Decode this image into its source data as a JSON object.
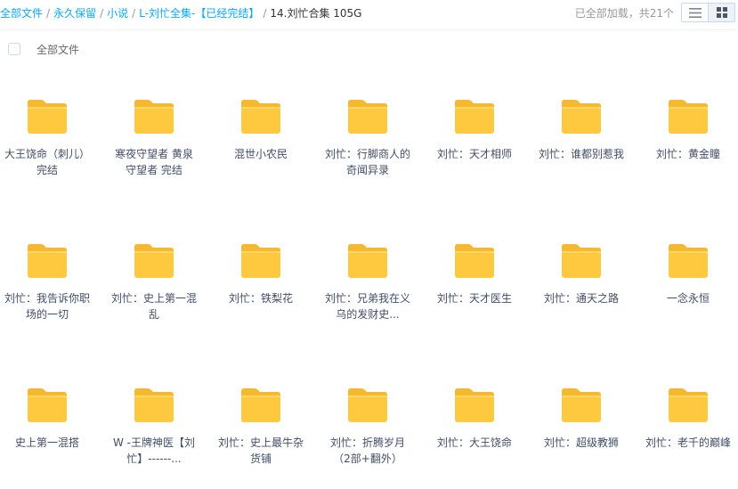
{
  "breadcrumb": {
    "crumbs": [
      "全部文件",
      "永久保留",
      "小说",
      "L-刘忙全集-【已经完结】"
    ],
    "current": "14.刘忙合集 105G"
  },
  "status": {
    "loaded_text": "已全部加载，共21个"
  },
  "view_toggle": {
    "list_icon": "list-view-icon",
    "grid_icon": "grid-view-icon",
    "active": "grid"
  },
  "header": {
    "select_all_label": "全部文件"
  },
  "colors": {
    "accent": "#09aaff",
    "folder": "#ffc93f",
    "folder_back": "#f5b82e",
    "text": "#424e67"
  },
  "folders": [
    {
      "name": "大王饶命（刺儿）完结"
    },
    {
      "name": "寒夜守望者 黄泉守望者 完结"
    },
    {
      "name": "混世小农民"
    },
    {
      "name": "刘忙：行脚商人的奇闻异录"
    },
    {
      "name": "刘忙：天才相师"
    },
    {
      "name": "刘忙：谁都别惹我"
    },
    {
      "name": "刘忙：黄金瞳"
    },
    {
      "name": "刘忙：我告诉你职场的一切"
    },
    {
      "name": "刘忙：史上第一混乱"
    },
    {
      "name": "刘忙：铁梨花"
    },
    {
      "name": "刘忙：兄弟我在义乌的发财史..."
    },
    {
      "name": "刘忙：天才医生"
    },
    {
      "name": "刘忙：通天之路"
    },
    {
      "name": "一念永恒"
    },
    {
      "name": "史上第一混搭"
    },
    {
      "name": "W -王牌神医【刘忙】------..."
    },
    {
      "name": "刘忙：史上最牛杂货铺"
    },
    {
      "name": "刘忙：折腾岁月（2部+翻外）"
    },
    {
      "name": "刘忙：大王饶命"
    },
    {
      "name": "刘忙：超级教狮"
    },
    {
      "name": "刘忙：老千的巅峰"
    }
  ]
}
